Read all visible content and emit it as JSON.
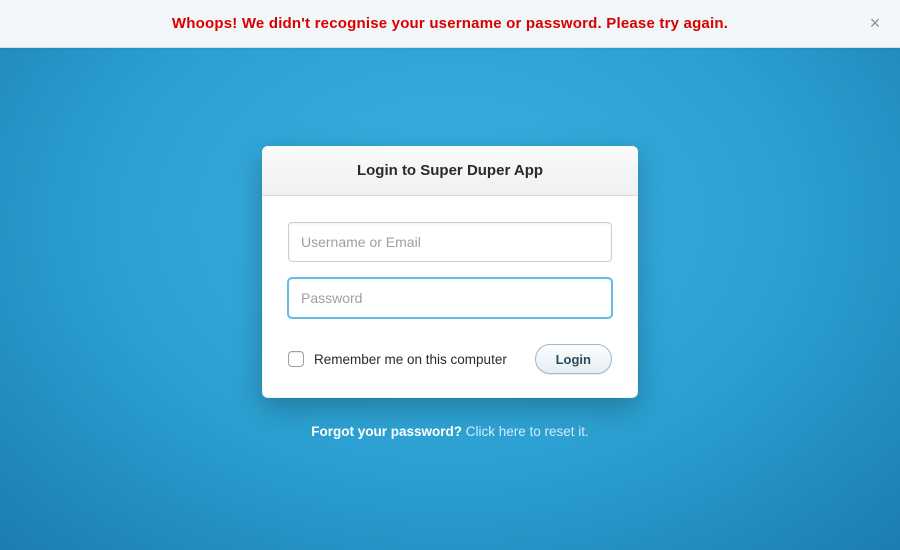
{
  "alert": {
    "message": "Whoops! We didn't recognise your username or password. Please try again.",
    "close_label": "×"
  },
  "card": {
    "title": "Login to Super Duper App",
    "username": {
      "value": "",
      "placeholder": "Username or Email"
    },
    "password": {
      "value": "",
      "placeholder": "Password"
    },
    "remember_label": "Remember me on this computer",
    "remember_checked": false,
    "login_label": "Login"
  },
  "below": {
    "question": "Forgot your password?",
    "link_text": "Click here to reset it."
  },
  "colors": {
    "error": "#d90000",
    "bg_primary": "#2a9fd6",
    "card_bg": "#ffffff"
  }
}
